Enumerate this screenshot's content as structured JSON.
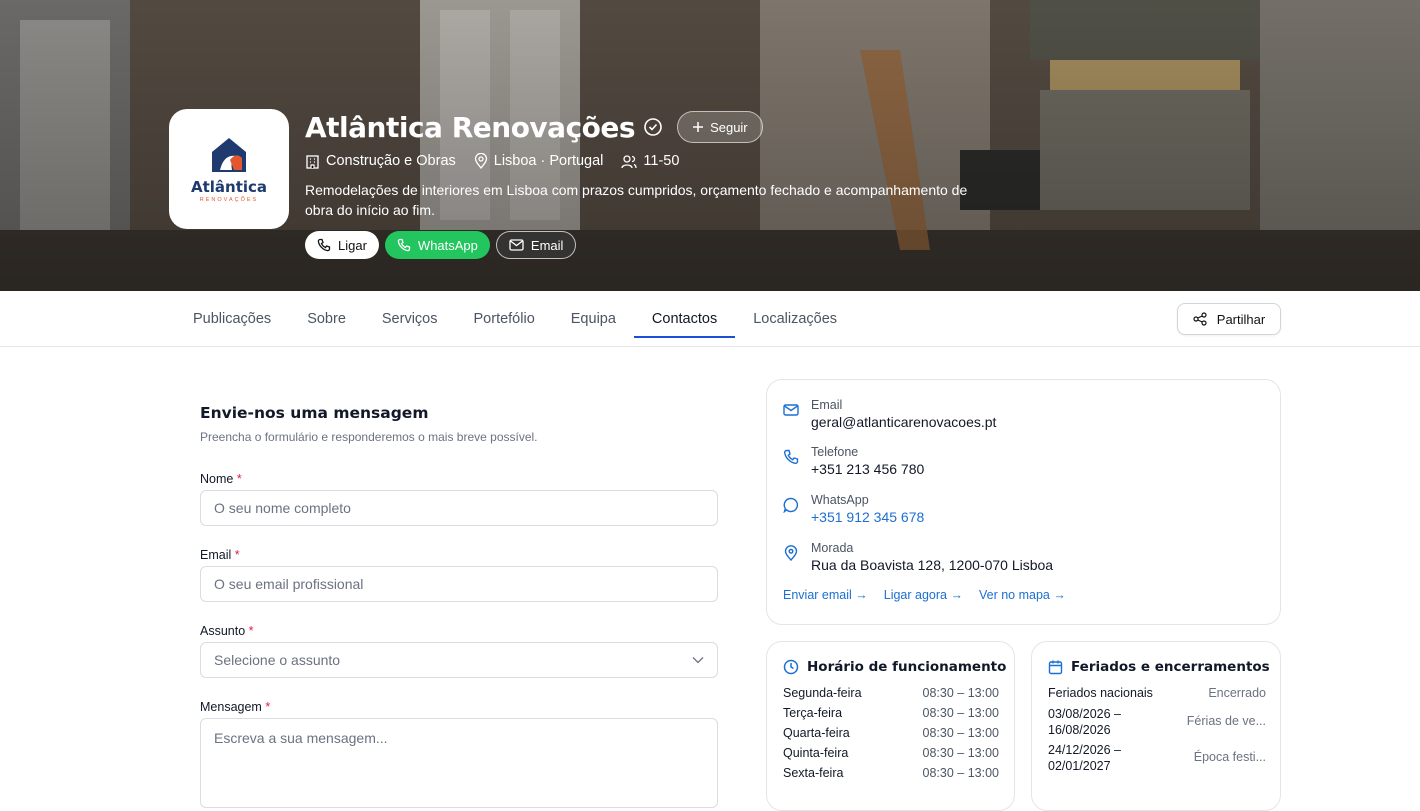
{
  "company": {
    "name": "Atlântica Renovações",
    "logo_word": "Atlântica",
    "logo_sub": "RENOVAÇÕES",
    "follow_label": "Seguir",
    "category": "Construção e Obras",
    "location": "Lisboa · Portugal",
    "size": "11-50",
    "description": "Remodelações de interiores em Lisboa com prazos cumpridos, orçamento fechado e acompanhamento de obra do início ao fim."
  },
  "actions": {
    "call": "Ligar",
    "whatsapp": "WhatsApp",
    "email": "Email"
  },
  "tabs": [
    "Publicações",
    "Sobre",
    "Serviços",
    "Portefólio",
    "Equipa",
    "Contactos",
    "Localizações"
  ],
  "active_tab": "Contactos",
  "share_label": "Partilhar",
  "form": {
    "title": "Envie-nos uma mensagem",
    "subtitle": "Preencha o formulário e responderemos o mais breve possível.",
    "name_label": "Nome",
    "name_placeholder": "O seu nome completo",
    "email_label": "Email",
    "email_placeholder": "O seu email profissional",
    "subject_label": "Assunto",
    "subject_placeholder": "Selecione o assunto",
    "message_label": "Mensagem",
    "message_placeholder": "Escreva a sua mensagem...",
    "required_mark": "*"
  },
  "contact": {
    "email_label": "Email",
    "email_value": "geral@atlanticarenovacoes.pt",
    "phone_label": "Telefone",
    "phone_value": "+351 213 456 780",
    "whatsapp_label": "WhatsApp",
    "whatsapp_value": "+351 912 345 678",
    "address_label": "Morada",
    "address_value": "Rua da Boavista 128, 1200-070 Lisboa",
    "link_email": "Enviar email →",
    "link_call": "Ligar agora →",
    "link_map": "Ver no mapa →"
  },
  "hours": {
    "title": "Horário de funcionamento",
    "rows": [
      {
        "day": "Segunda-feira",
        "time": "08:30 – 13:00"
      },
      {
        "day": "Terça-feira",
        "time": "08:30 – 13:00"
      },
      {
        "day": "Quarta-feira",
        "time": "08:30 – 13:00"
      },
      {
        "day": "Quinta-feira",
        "time": "08:30 – 13:00"
      },
      {
        "day": "Sexta-feira",
        "time": "08:30 – 13:00"
      }
    ]
  },
  "holidays": {
    "title": "Feriados e encerramentos",
    "rows": [
      {
        "date": "Feriados nacionais",
        "note": "Encerrado"
      },
      {
        "date": "03/08/2026 – 16/08/2026",
        "note": "Férias de ve..."
      },
      {
        "date": "24/12/2026 – 02/01/2027",
        "note": "Época festi..."
      }
    ]
  },
  "colors": {
    "accent": "#1d4ed8",
    "whatsapp": "#22c55e",
    "link": "#1d6fd1",
    "required": "#e11d48"
  }
}
